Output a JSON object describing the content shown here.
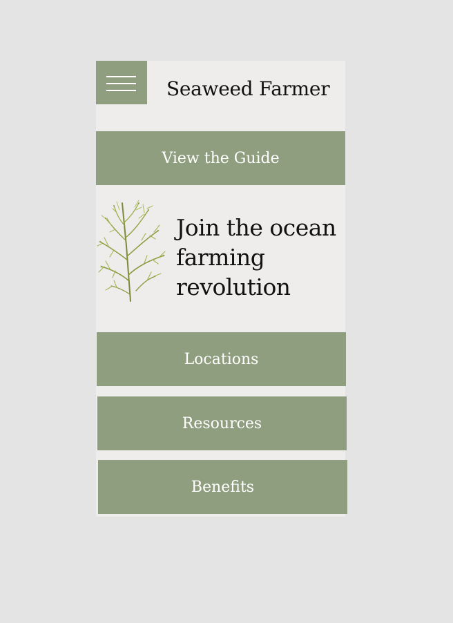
{
  "header": {
    "title": "Seaweed Farmer",
    "menu_icon": "hamburger-menu-icon"
  },
  "guide_button": {
    "label": "View the Guide"
  },
  "hero": {
    "headline": "Join the ocean farming revolution",
    "image": "seaweed-illustration"
  },
  "nav": {
    "locations_label": "Locations",
    "resources_label": "Resources",
    "benefits_label": "Benefits"
  },
  "colors": {
    "background": "#e4e4e4",
    "panel": "#eeedeb",
    "accent_green": "#8f9e7f",
    "text": "#111111"
  }
}
